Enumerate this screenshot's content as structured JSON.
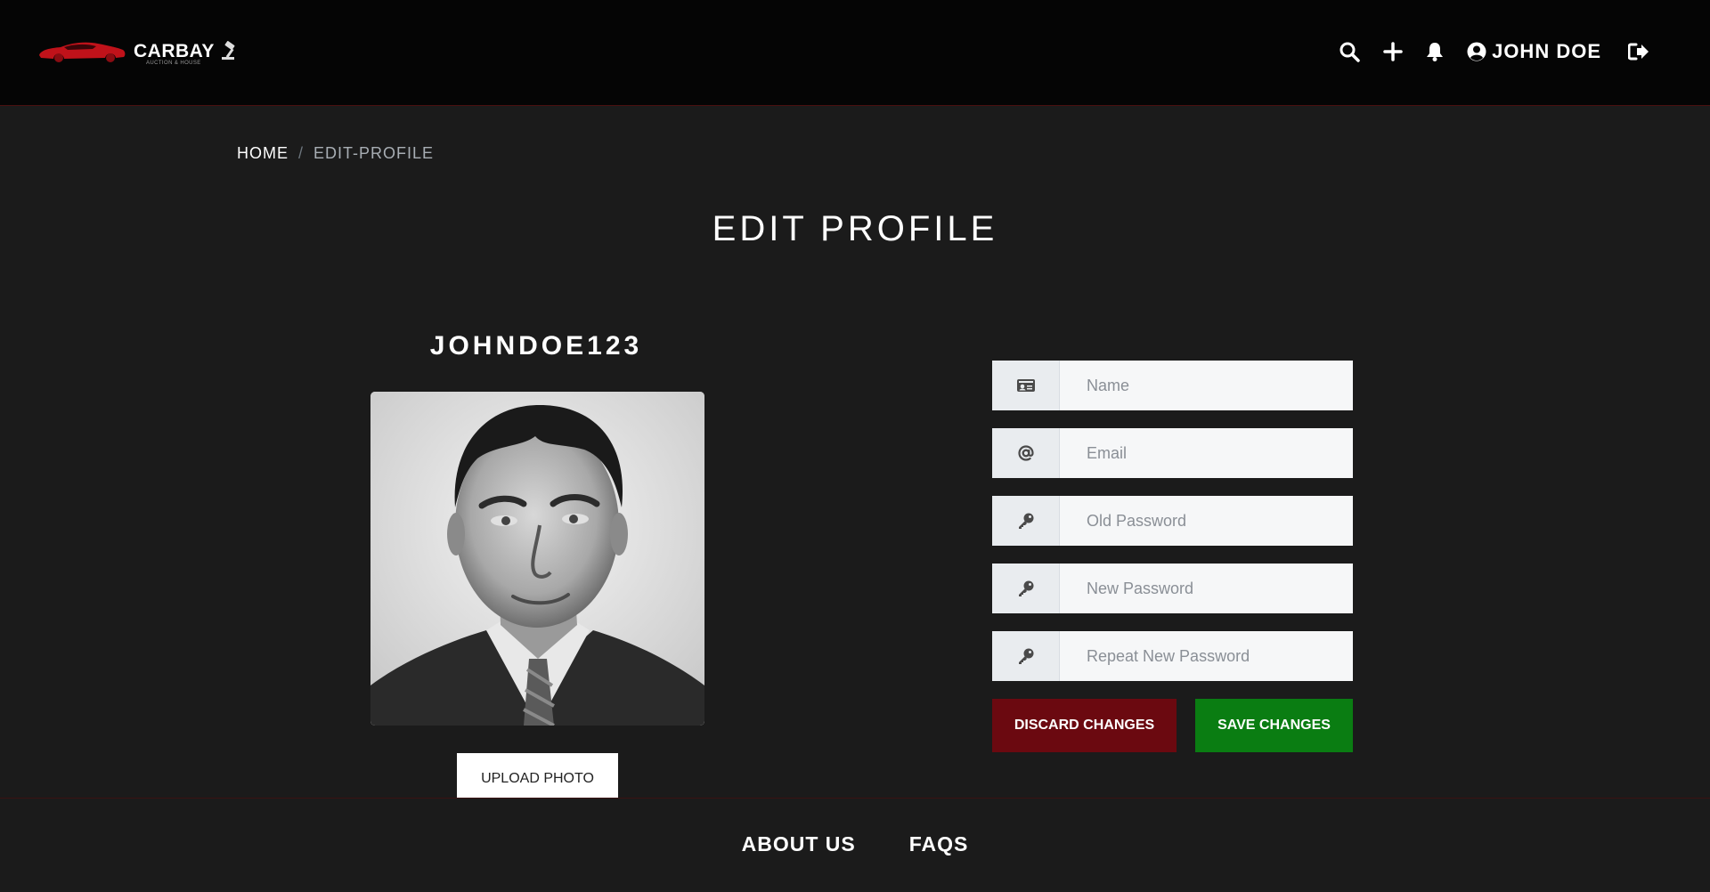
{
  "brand": {
    "name": "CARBAY",
    "tagline": "AUCTION & HOUSE",
    "accent": "#c0121a"
  },
  "nav": {
    "icons": [
      "search-icon",
      "plus-icon",
      "bell-icon",
      "user-circle-icon",
      "sign-out-icon"
    ],
    "user_name": "JOHN DOE"
  },
  "breadcrumb": {
    "home": "HOME",
    "separator": "/",
    "current": "EDIT-PROFILE"
  },
  "page": {
    "title": "EDIT PROFILE"
  },
  "profile": {
    "username": "JOHNDOE123",
    "upload_label": "UPLOAD PHOTO"
  },
  "form": {
    "fields": [
      {
        "icon": "id-card-icon",
        "placeholder": "Name",
        "value": ""
      },
      {
        "icon": "at-icon",
        "placeholder": "Email",
        "value": ""
      },
      {
        "icon": "key-icon",
        "placeholder": "Old Password",
        "value": ""
      },
      {
        "icon": "key-icon",
        "placeholder": "New Password",
        "value": ""
      },
      {
        "icon": "key-icon",
        "placeholder": "Repeat New Password",
        "value": ""
      }
    ],
    "discard_label": "DISCARD CHANGES",
    "save_label": "SAVE CHANGES",
    "discard_color": "#6b0910",
    "save_color": "#0a7d12"
  },
  "footer": {
    "links": [
      "ABOUT US",
      "FAQS"
    ]
  }
}
